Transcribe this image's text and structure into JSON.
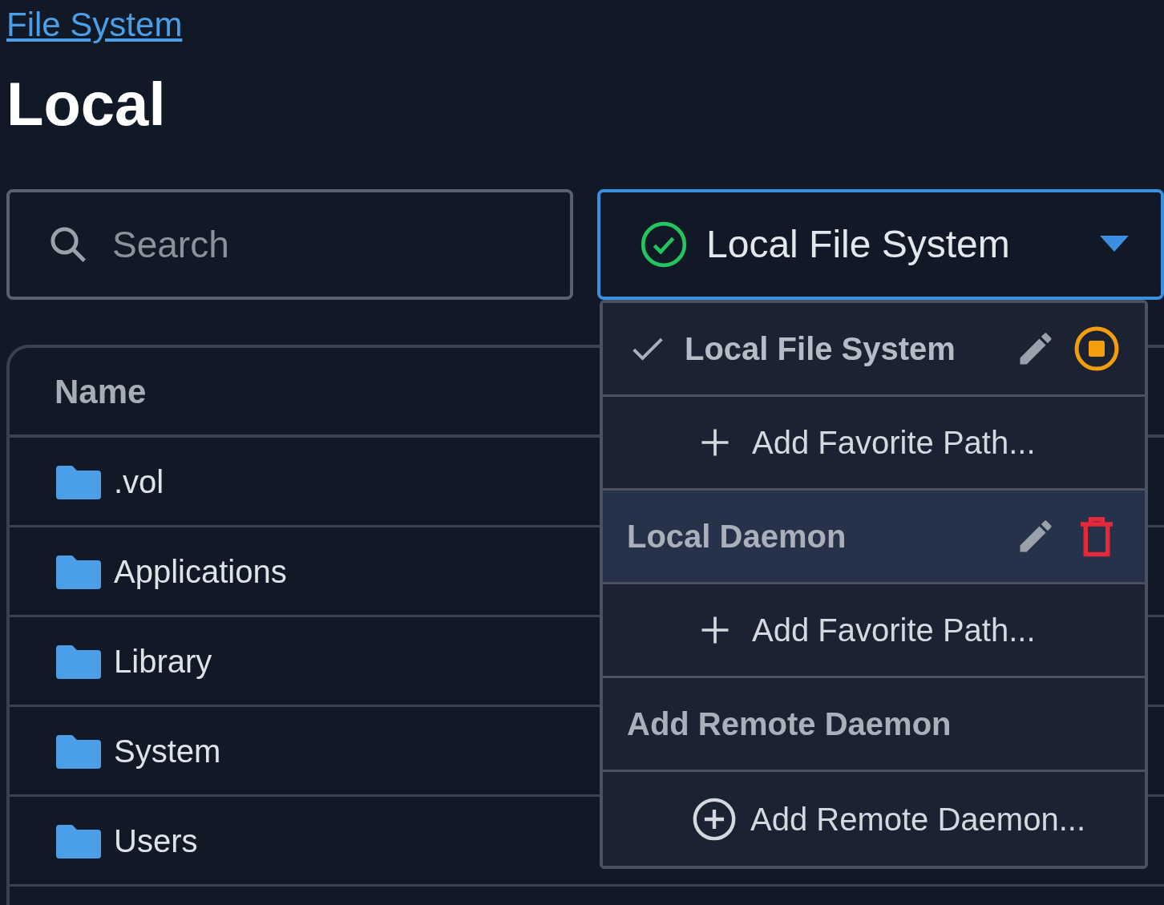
{
  "breadcrumb": {
    "label": "File System"
  },
  "title": "Local",
  "search": {
    "placeholder": "Search"
  },
  "source_select": {
    "value": "Local File System",
    "connected": true
  },
  "table": {
    "columns": [
      "Name"
    ],
    "rows": [
      {
        "name": ".vol"
      },
      {
        "name": "Applications"
      },
      {
        "name": "Library"
      },
      {
        "name": "System"
      },
      {
        "name": "Users"
      }
    ]
  },
  "menu": {
    "items": [
      {
        "kind": "source",
        "label": "Local File System",
        "selected": true,
        "highlighted": false,
        "running": true
      },
      {
        "kind": "add_path",
        "label": "Add Favorite Path..."
      },
      {
        "kind": "source",
        "label": "Local Daemon",
        "selected": false,
        "highlighted": true,
        "running": false
      },
      {
        "kind": "add_path",
        "label": "Add Favorite Path..."
      },
      {
        "kind": "header",
        "label": "Add Remote Daemon"
      },
      {
        "kind": "add_remote",
        "label": "Add Remote Daemon..."
      }
    ]
  }
}
